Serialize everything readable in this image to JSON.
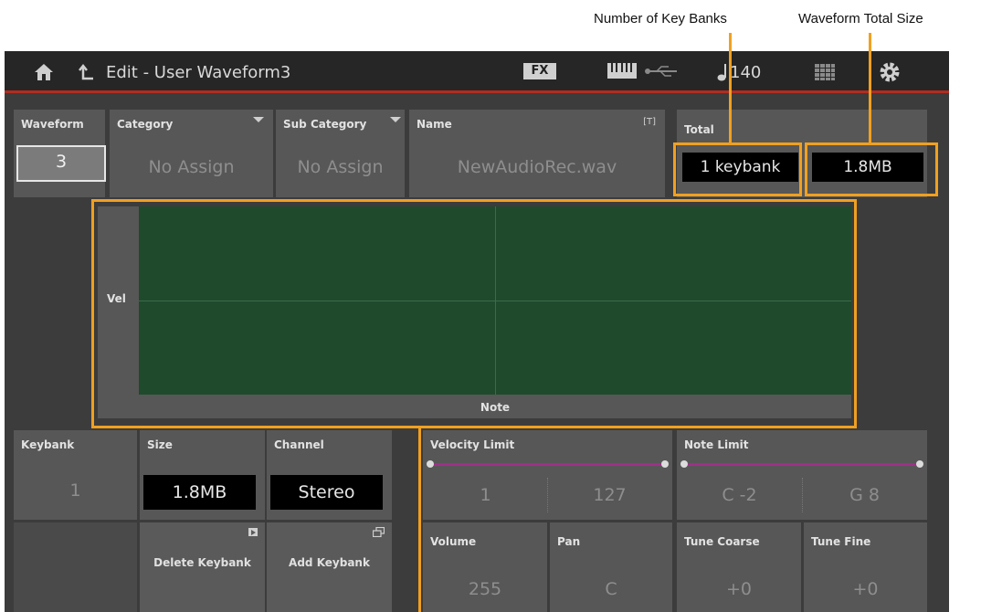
{
  "callouts": {
    "key_banks": "Number of Key Banks",
    "total_size": "Waveform Total Size"
  },
  "topbar": {
    "title": "Edit - User Waveform3",
    "fx_label": "FX",
    "tempo": "140"
  },
  "header_fields": {
    "waveform": {
      "label": "Waveform",
      "value": "3"
    },
    "category": {
      "label": "Category",
      "value": "No Assign"
    },
    "sub_category": {
      "label": "Sub Category",
      "value": "No Assign"
    },
    "name": {
      "label": "Name",
      "value": "NewAudioRec.wav",
      "text_tag": "[T]"
    },
    "total": {
      "label": "Total",
      "keybanks": "1 keybank",
      "size": "1.8MB"
    }
  },
  "graph": {
    "vel_label": "Vel",
    "note_label": "Note"
  },
  "keybank_fields": {
    "keybank": {
      "label": "Keybank",
      "value": "1"
    },
    "size": {
      "label": "Size",
      "value": "1.8MB"
    },
    "channel": {
      "label": "Channel",
      "value": "Stereo"
    }
  },
  "velocity_limit": {
    "label": "Velocity Limit",
    "low": "1",
    "high": "127"
  },
  "note_limit": {
    "label": "Note Limit",
    "low": "C -2",
    "high": "G 8"
  },
  "actions": {
    "delete_keybank": "Delete Keybank",
    "add_keybank": "Add Keybank"
  },
  "params": {
    "volume": {
      "label": "Volume",
      "value": "255"
    },
    "pan": {
      "label": "Pan",
      "value": "C"
    },
    "tune_coarse": {
      "label": "Tune Coarse",
      "value": "+0"
    },
    "tune_fine": {
      "label": "Tune Fine",
      "value": "+0"
    }
  },
  "colors": {
    "accent_red": "#b02d22",
    "callout_orange": "#f0a020",
    "graph_green": "#1f4a2c",
    "slider_purple": "#a0308a"
  }
}
